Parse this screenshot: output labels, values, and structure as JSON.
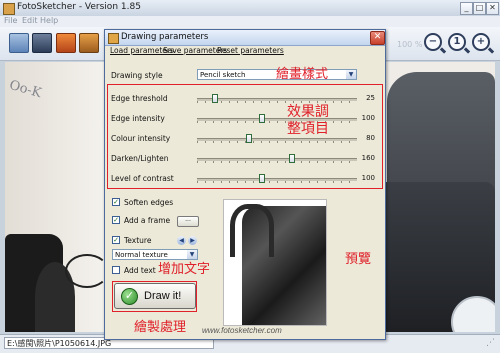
{
  "window": {
    "title": "FotoSketcher - Version 1.85",
    "controls": {
      "minimize": "_",
      "maximize": "□",
      "close": "✕"
    }
  },
  "menu": [
    "File",
    "Edit",
    "Help"
  ],
  "toolbar": {
    "icons": [
      "open-folder-icon",
      "save-disk-icon",
      "paste-icon",
      "copy-icon",
      "print-icon"
    ],
    "zoom_label": "100 %",
    "zoom_buttons": [
      "−",
      "1",
      "+"
    ]
  },
  "photo": {
    "handwriting": "Oo-K"
  },
  "status": {
    "path": "E:\\感閩\\照片\\P1050614.JPG"
  },
  "dialog": {
    "title": "Drawing parameters",
    "close": "✕",
    "menu": [
      "Load parameters",
      "Save parameters",
      "Reset parameters"
    ],
    "style_label": "Drawing style",
    "style_value": "Pencil sketch",
    "sliders": [
      {
        "label": "Edge threshold",
        "value": "25",
        "fraction": 0.1
      },
      {
        "label": "Edge intensity",
        "value": "100",
        "fraction": 0.4
      },
      {
        "label": "Colour intensity",
        "value": "80",
        "fraction": 0.32
      },
      {
        "label": "Darken/Lighten",
        "value": "160",
        "fraction": 0.6
      },
      {
        "label": "Level of contrast",
        "value": "100",
        "fraction": 0.4
      }
    ],
    "options": {
      "soften_edges": {
        "label": "Soften edges",
        "checked": true
      },
      "add_frame": {
        "label": "Add a frame",
        "checked": true,
        "button": "..."
      },
      "texture": {
        "label": "Texture",
        "checked": true,
        "value": "Normal texture"
      },
      "add_text": {
        "label": "Add text",
        "checked": false
      }
    },
    "draw_button": "Draw it!",
    "url": "www.fotosketcher.com"
  },
  "annotations": {
    "style": "繪畫樣式",
    "adjust_line1": "效果調",
    "adjust_line2": "整項目",
    "add_text": "增加文字",
    "preview": "預覽",
    "draw": "繪製處理"
  },
  "colors": {
    "annotation": "#e0202a",
    "dialog_bg": "#ece9d8",
    "title_gradient_end": "#c3d5ee"
  }
}
